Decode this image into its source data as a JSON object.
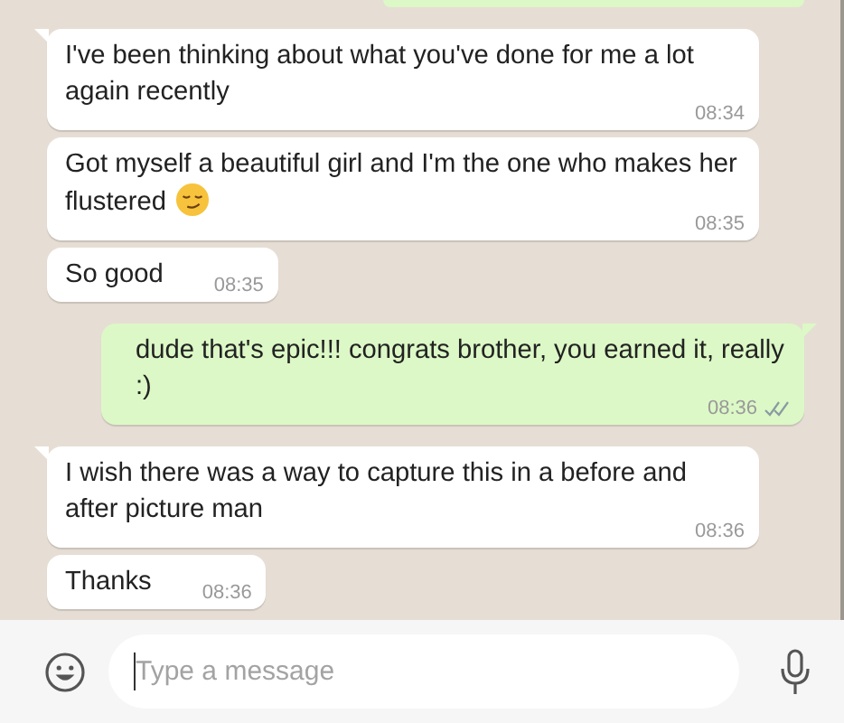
{
  "messages": [
    {
      "kind": "outgoing",
      "partial": true
    },
    {
      "kind": "incoming",
      "tail": true,
      "text": "I've been thinking about what you've done for me a lot again recently",
      "time": "08:34"
    },
    {
      "kind": "incoming",
      "tail": false,
      "text": "Got myself a beautiful girl and I'm the one who makes her flustered",
      "trailing_emoji": true,
      "time": "08:35"
    },
    {
      "kind": "incoming",
      "tail": false,
      "text": "So good",
      "time": "08:35"
    },
    {
      "kind": "outgoing",
      "tail": true,
      "text": "dude that's epic!!! congrats brother, you earned it, really :)",
      "time": "08:36",
      "read": false
    },
    {
      "kind": "incoming",
      "tail": true,
      "text": "I wish there was a way to capture this in a before and after picture man",
      "time": "08:36"
    },
    {
      "kind": "incoming",
      "tail": false,
      "text": "Thanks",
      "time": "08:36"
    }
  ],
  "composer": {
    "placeholder": "Type a message",
    "focused": true
  }
}
